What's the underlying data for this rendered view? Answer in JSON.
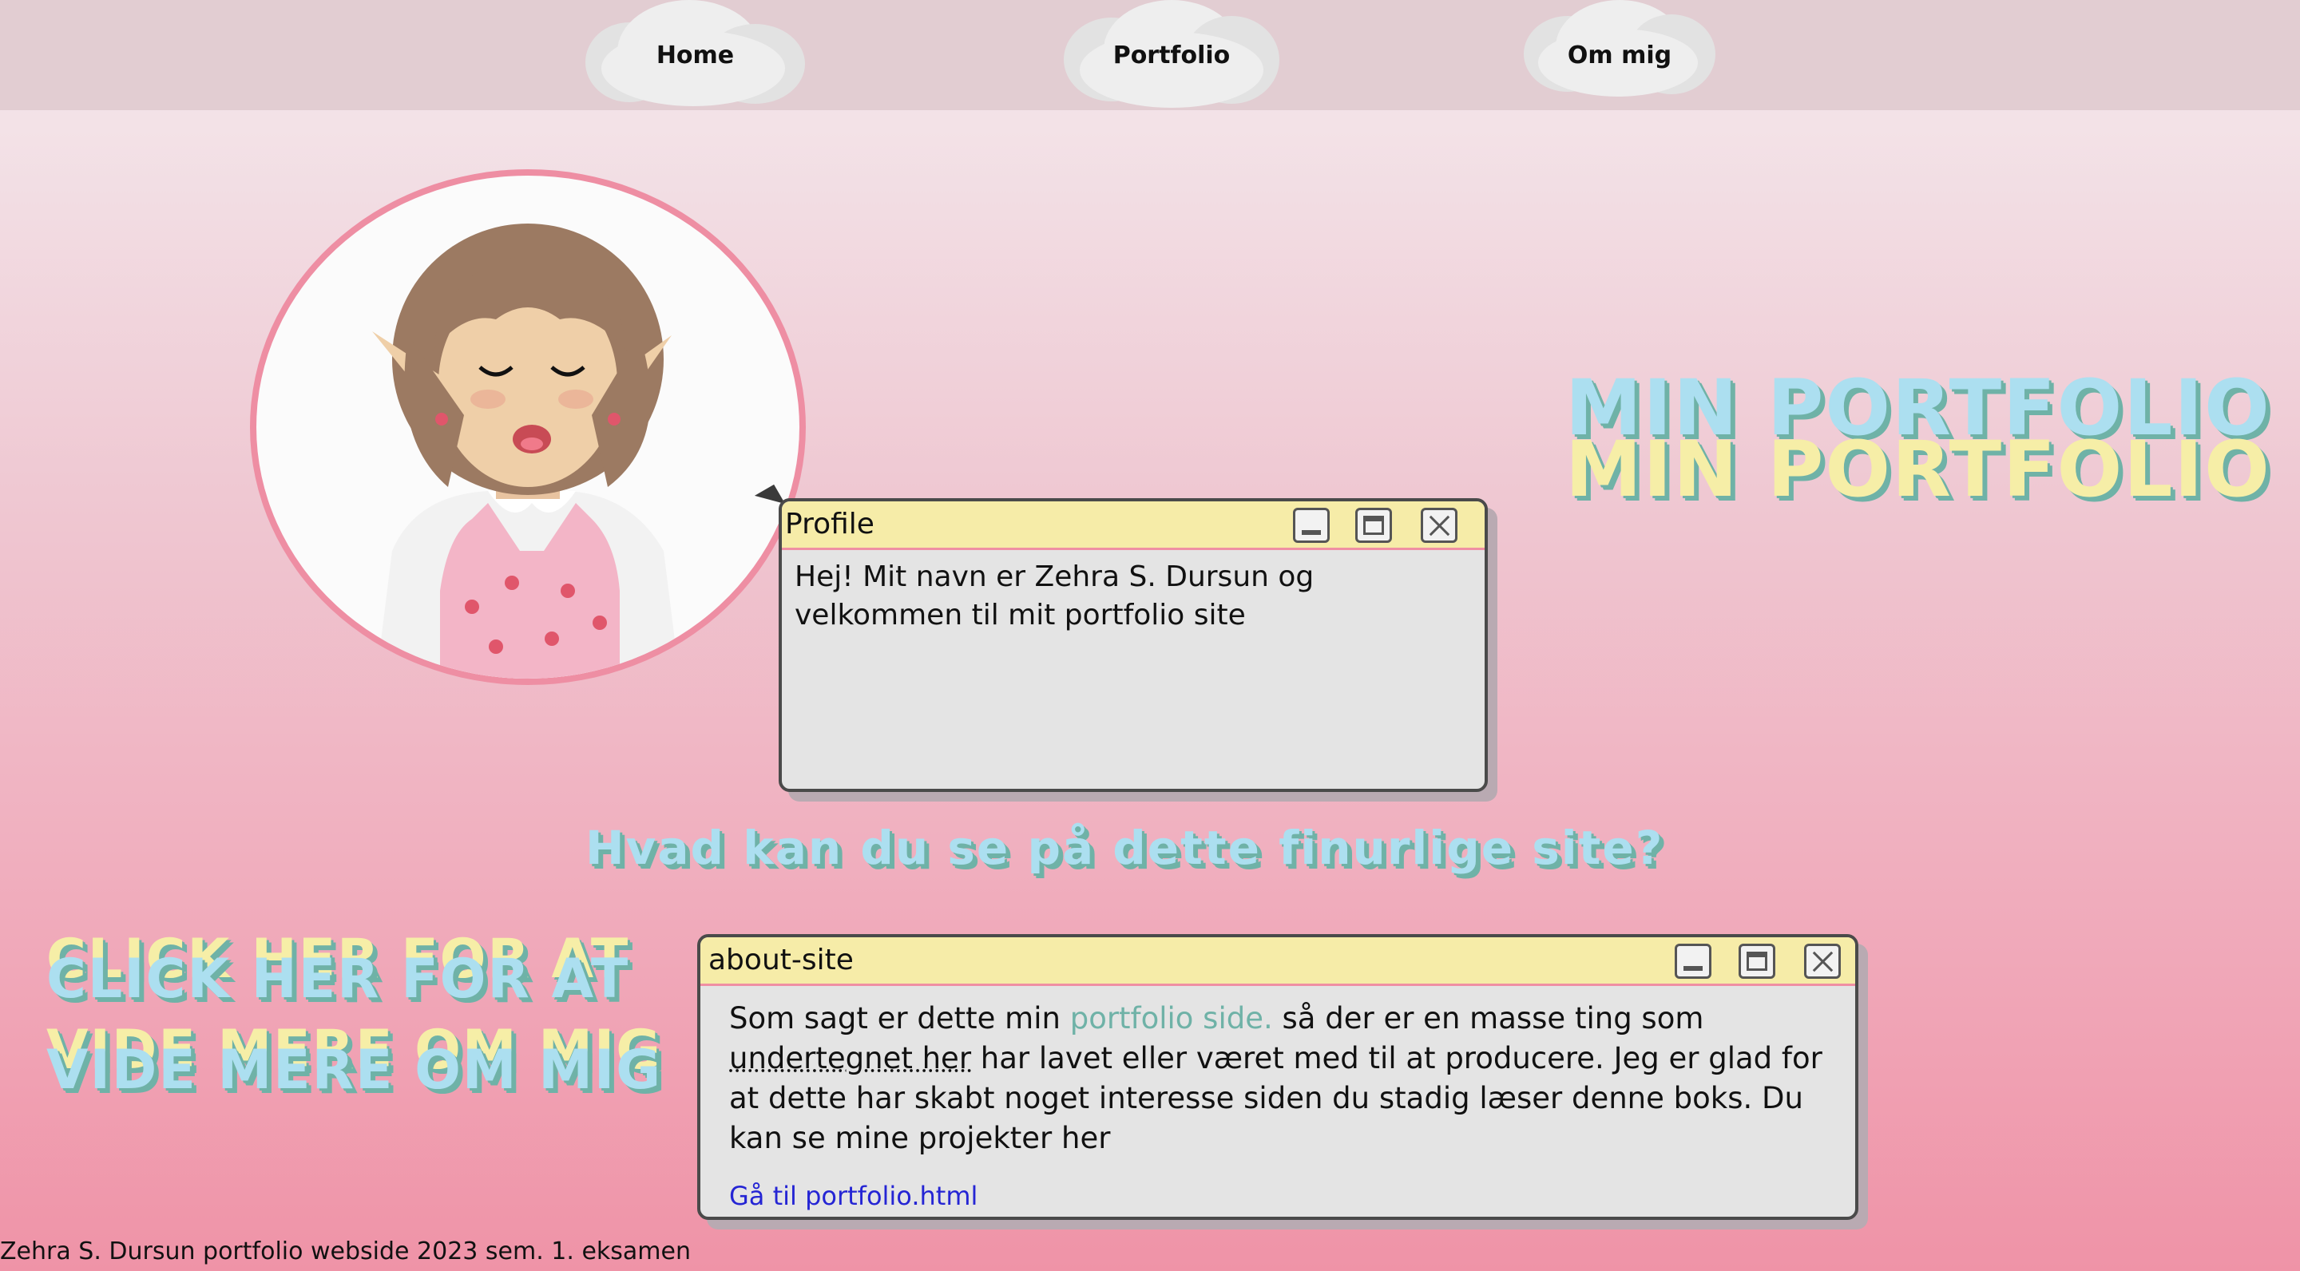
{
  "nav": {
    "items": [
      {
        "label": "Home"
      },
      {
        "label": "Portfolio"
      },
      {
        "label": "Om mig"
      }
    ]
  },
  "hero": {
    "title_blue": "MIN PORTFOLIO",
    "title_yellow": "MIN PORTFOLIO"
  },
  "profile_window": {
    "title": "Profile",
    "text": "Hej! Mit navn er Zehra S. Dursun og velkommen til mit portfolio site"
  },
  "sub_heading": "Hvad kan du se på dette finurlige site?",
  "cta": {
    "line1": "CLICK HER FOR AT",
    "line2": "VIDE MERE OM MIG"
  },
  "about_window": {
    "title": "about-site",
    "text_part1": "Som sagt er dette min ",
    "text_link": "portfolio side.",
    "text_part2": " så der er en masse ting som ",
    "text_underlined": "undertegnet her",
    "text_part3": " har lavet eller været med til at producere. Jeg er glad for at dette har skabt noget interesse siden du stadig læser denne boks. Du kan se mine projekter her",
    "go_link": "Gå til portfolio.html"
  },
  "footer": "Zehra S. Dursun portfolio webside 2023 sem. 1. eksamen",
  "colors": {
    "accent_blue": "#acdff0",
    "accent_yellow": "#f6eea7",
    "accent_teal": "#6fb2a7",
    "avatar_border": "#ee8ea3",
    "window_title_bg": "#f6eca8",
    "nav_bg": "#e2cdd2"
  }
}
